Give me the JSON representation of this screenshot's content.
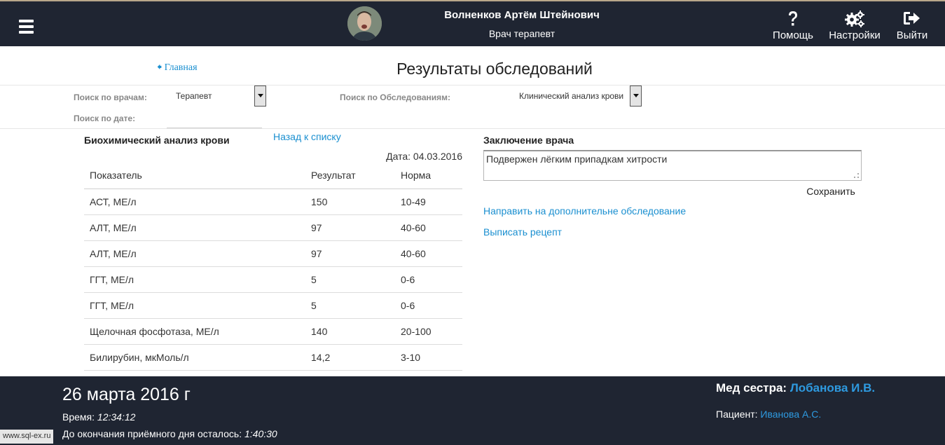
{
  "header": {
    "menu_icon": "hamburger-icon",
    "user_name": "Волненков Артём Штейнович",
    "user_role": "Врач терапевт",
    "actions": [
      {
        "icon": "question-icon",
        "label": "Помощь"
      },
      {
        "icon": "gears-icon",
        "label": "Настройки"
      },
      {
        "icon": "sign-out-icon",
        "label": "Выйти"
      }
    ]
  },
  "nav": {
    "home_link": "Главная",
    "page_title": "Результаты обследований"
  },
  "filters": {
    "doctor_label": "Поиск по врачам:",
    "doctor_value": "Терапевт",
    "exam_label": "Поиск по Обследованиям:",
    "exam_value": "Клинический анализ крови",
    "date_label": "Поиск по дате:",
    "date_value": ""
  },
  "analysis": {
    "title": "Биохимический анализ крови",
    "back_link": "Назад к списку",
    "date_line": "Дата: 04.03.2016",
    "columns": [
      "Показатель",
      "Результат",
      "Норма"
    ],
    "rows": [
      [
        "АСТ, МЕ/л",
        "150",
        "10-49"
      ],
      [
        "АЛТ, МЕ/л",
        "97",
        "40-60"
      ],
      [
        "АЛТ, МЕ/л",
        "97",
        "40-60"
      ],
      [
        "ГГТ, МЕ/л",
        "5",
        "0-6"
      ],
      [
        "ГГТ, МЕ/л",
        "5",
        "0-6"
      ],
      [
        "Щелочная фосфотаза, МЕ/л",
        "140",
        "20-100"
      ],
      [
        "Билирубин, мкМоль/л",
        "14,2",
        "3-10"
      ]
    ]
  },
  "conclusion": {
    "title": "Заключение врача",
    "text": "Подвержен лёгким припадкам хитрости",
    "save_label": "Сохранить",
    "refer_link": "Направить на дополнительне обследование",
    "prescription_link": "Выписать рецепт"
  },
  "footer": {
    "date": "26 марта 2016 г",
    "time_label": "Время:",
    "time_value": "12:34:12",
    "remaining_label": "До окончания приёмного дня осталось:",
    "remaining_value": "1:40:30",
    "nurse_label": "Мед сестра:",
    "nurse_value": "Лобанова И.В.",
    "patient_label": "Пациент:",
    "patient_value": "Иванова А.С."
  },
  "watermark": "www.sql-ex.ru",
  "colors": {
    "bar_bg": "#1f2532",
    "link": "#1a8fd0",
    "footer_accent": "#2e9ae0"
  }
}
